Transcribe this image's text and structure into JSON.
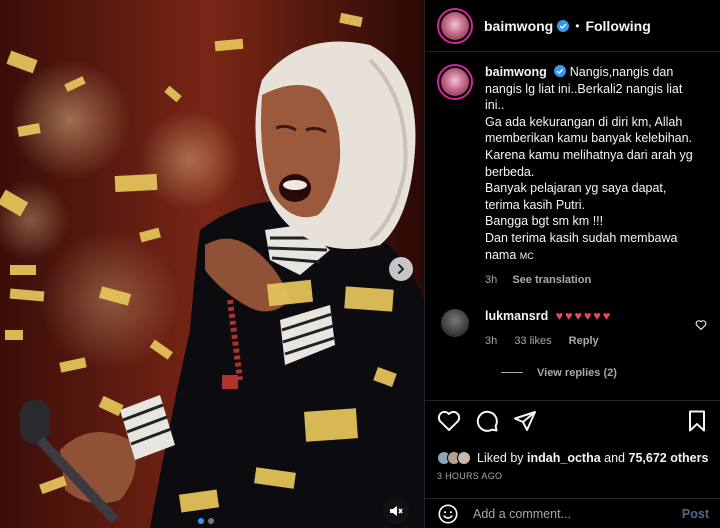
{
  "post": {
    "author": "baimwong",
    "separator": "•",
    "follow_status": "Following"
  },
  "caption": {
    "author": "baimwong",
    "lines": [
      "Nangis,nangis dan nangis lg liat ini..Berkali2 nangis liat ini..",
      "Ga ada kekurangan di diri km, Allah memberikan kamu banyak kelebihan. Karena kamu melihatnya dari arah yg berbeda.",
      "Banyak pelajaran yg saya dapat, terima kasih Putri.",
      "Bangga bgt sm km !!!",
      "Dan terima kasih sudah membawa nama",
      "MC"
    ],
    "age": "3h",
    "see_translation": "See translation"
  },
  "comment": {
    "author": "lukmansrd",
    "text": "♥♥♥♥♥♥",
    "age": "3h",
    "likes": "33 likes",
    "reply_label": "Reply",
    "view_replies": "View replies (2)"
  },
  "engagement": {
    "liked_by_prefix": "Liked by",
    "liked_by_user": "indah_octha",
    "and": "and",
    "others": "75,672 others",
    "timestamp": "3 HOURS AGO"
  },
  "composer": {
    "placeholder": "Add a comment...",
    "post_label": "Post"
  },
  "colors": {
    "accent_blue": "#3897f0",
    "heart_red": "#ed4956",
    "muted_text": "#a8a8a8",
    "border": "#262626"
  },
  "icons": {
    "media_next": "chevron-right-icon",
    "media_mute": "speaker-muted-icon",
    "verified": "verified-badge-icon",
    "like": "heart-outline-icon",
    "comment": "speech-bubble-icon",
    "share": "paper-plane-icon",
    "save": "bookmark-icon",
    "emoji": "smiley-icon"
  },
  "carousel": {
    "current": 1,
    "total": 2
  }
}
